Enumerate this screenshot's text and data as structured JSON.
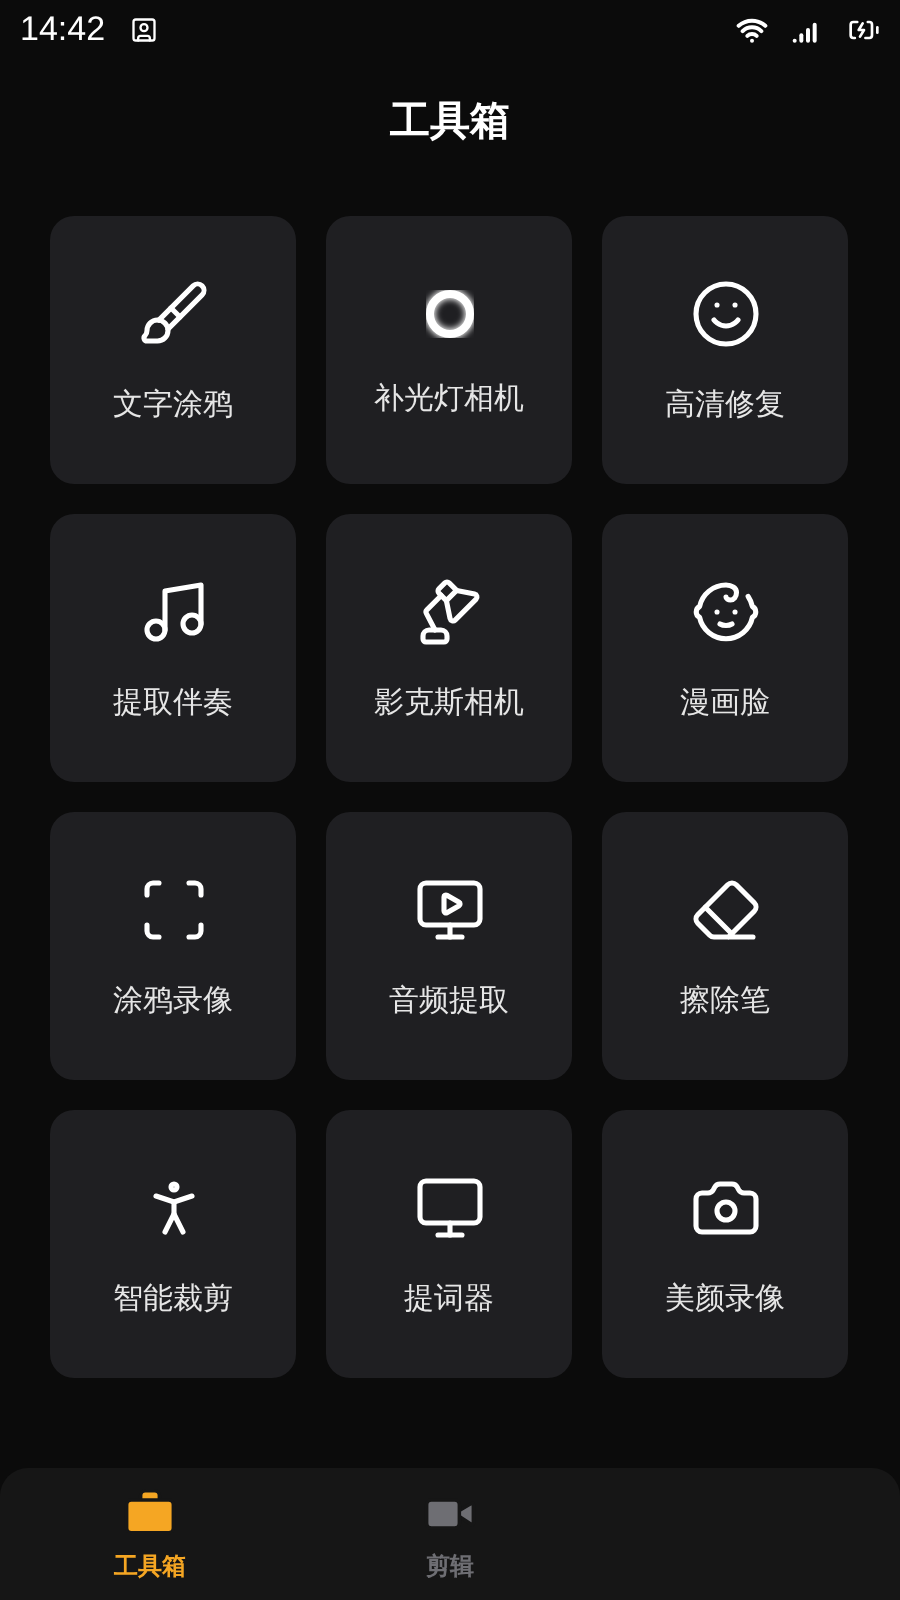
{
  "status_bar": {
    "time": "14:42"
  },
  "title": "工具箱",
  "tools": [
    {
      "label": "文字涂鸦"
    },
    {
      "label": "补光灯相机"
    },
    {
      "label": "高清修复"
    },
    {
      "label": "提取伴奏"
    },
    {
      "label": "影克斯相机"
    },
    {
      "label": "漫画脸"
    },
    {
      "label": "涂鸦录像"
    },
    {
      "label": "音频提取"
    },
    {
      "label": "擦除笔"
    },
    {
      "label": "智能裁剪"
    },
    {
      "label": "提词器"
    },
    {
      "label": "美颜录像"
    }
  ],
  "bottom_nav": [
    {
      "label": "工具箱",
      "selected": true
    },
    {
      "label": "剪辑",
      "selected": false
    }
  ]
}
